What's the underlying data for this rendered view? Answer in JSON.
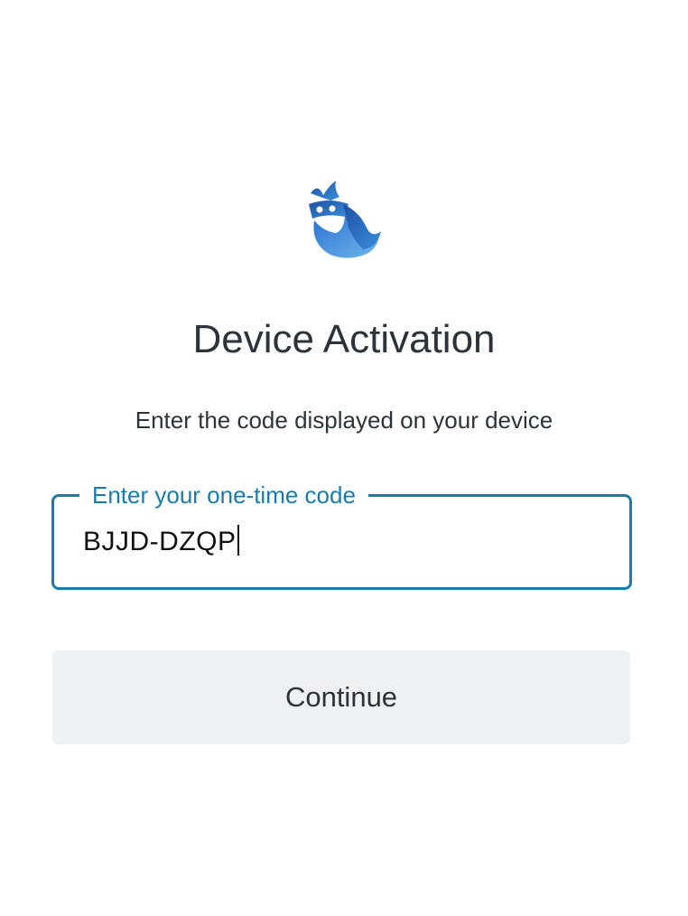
{
  "logo": {
    "icon": "owl-logo-icon",
    "colors": [
      "#1f5fb8",
      "#5fa8e8"
    ]
  },
  "header": {
    "title": "Device Activation",
    "subtitle": "Enter the code displayed on your device"
  },
  "code_field": {
    "label": "Enter your one-time code",
    "value": "BJJD-DZQP",
    "accent": "#1a7bae"
  },
  "actions": {
    "continue_label": "Continue"
  }
}
